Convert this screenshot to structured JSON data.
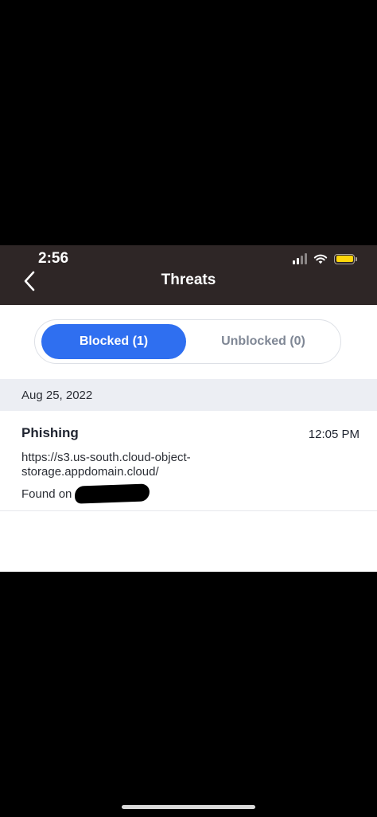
{
  "status_bar": {
    "time": "2:56",
    "battery_color": "#ffd60a"
  },
  "header": {
    "title": "Threats",
    "back_icon": "chevron-left-icon",
    "background": "#2e2626"
  },
  "tabs": [
    {
      "label": "Blocked (1)",
      "selected": true
    },
    {
      "label": "Unblocked (0)",
      "selected": false
    }
  ],
  "accent_color": "#2f6ff0",
  "threat_groups": [
    {
      "date": "Aug 25, 2022",
      "items": [
        {
          "type": "Phishing",
          "time": "12:05 PM",
          "url": "https://s3.us-south.cloud-object-storage.appdomain.cloud/",
          "found_on_label": "Found on"
        }
      ]
    }
  ]
}
